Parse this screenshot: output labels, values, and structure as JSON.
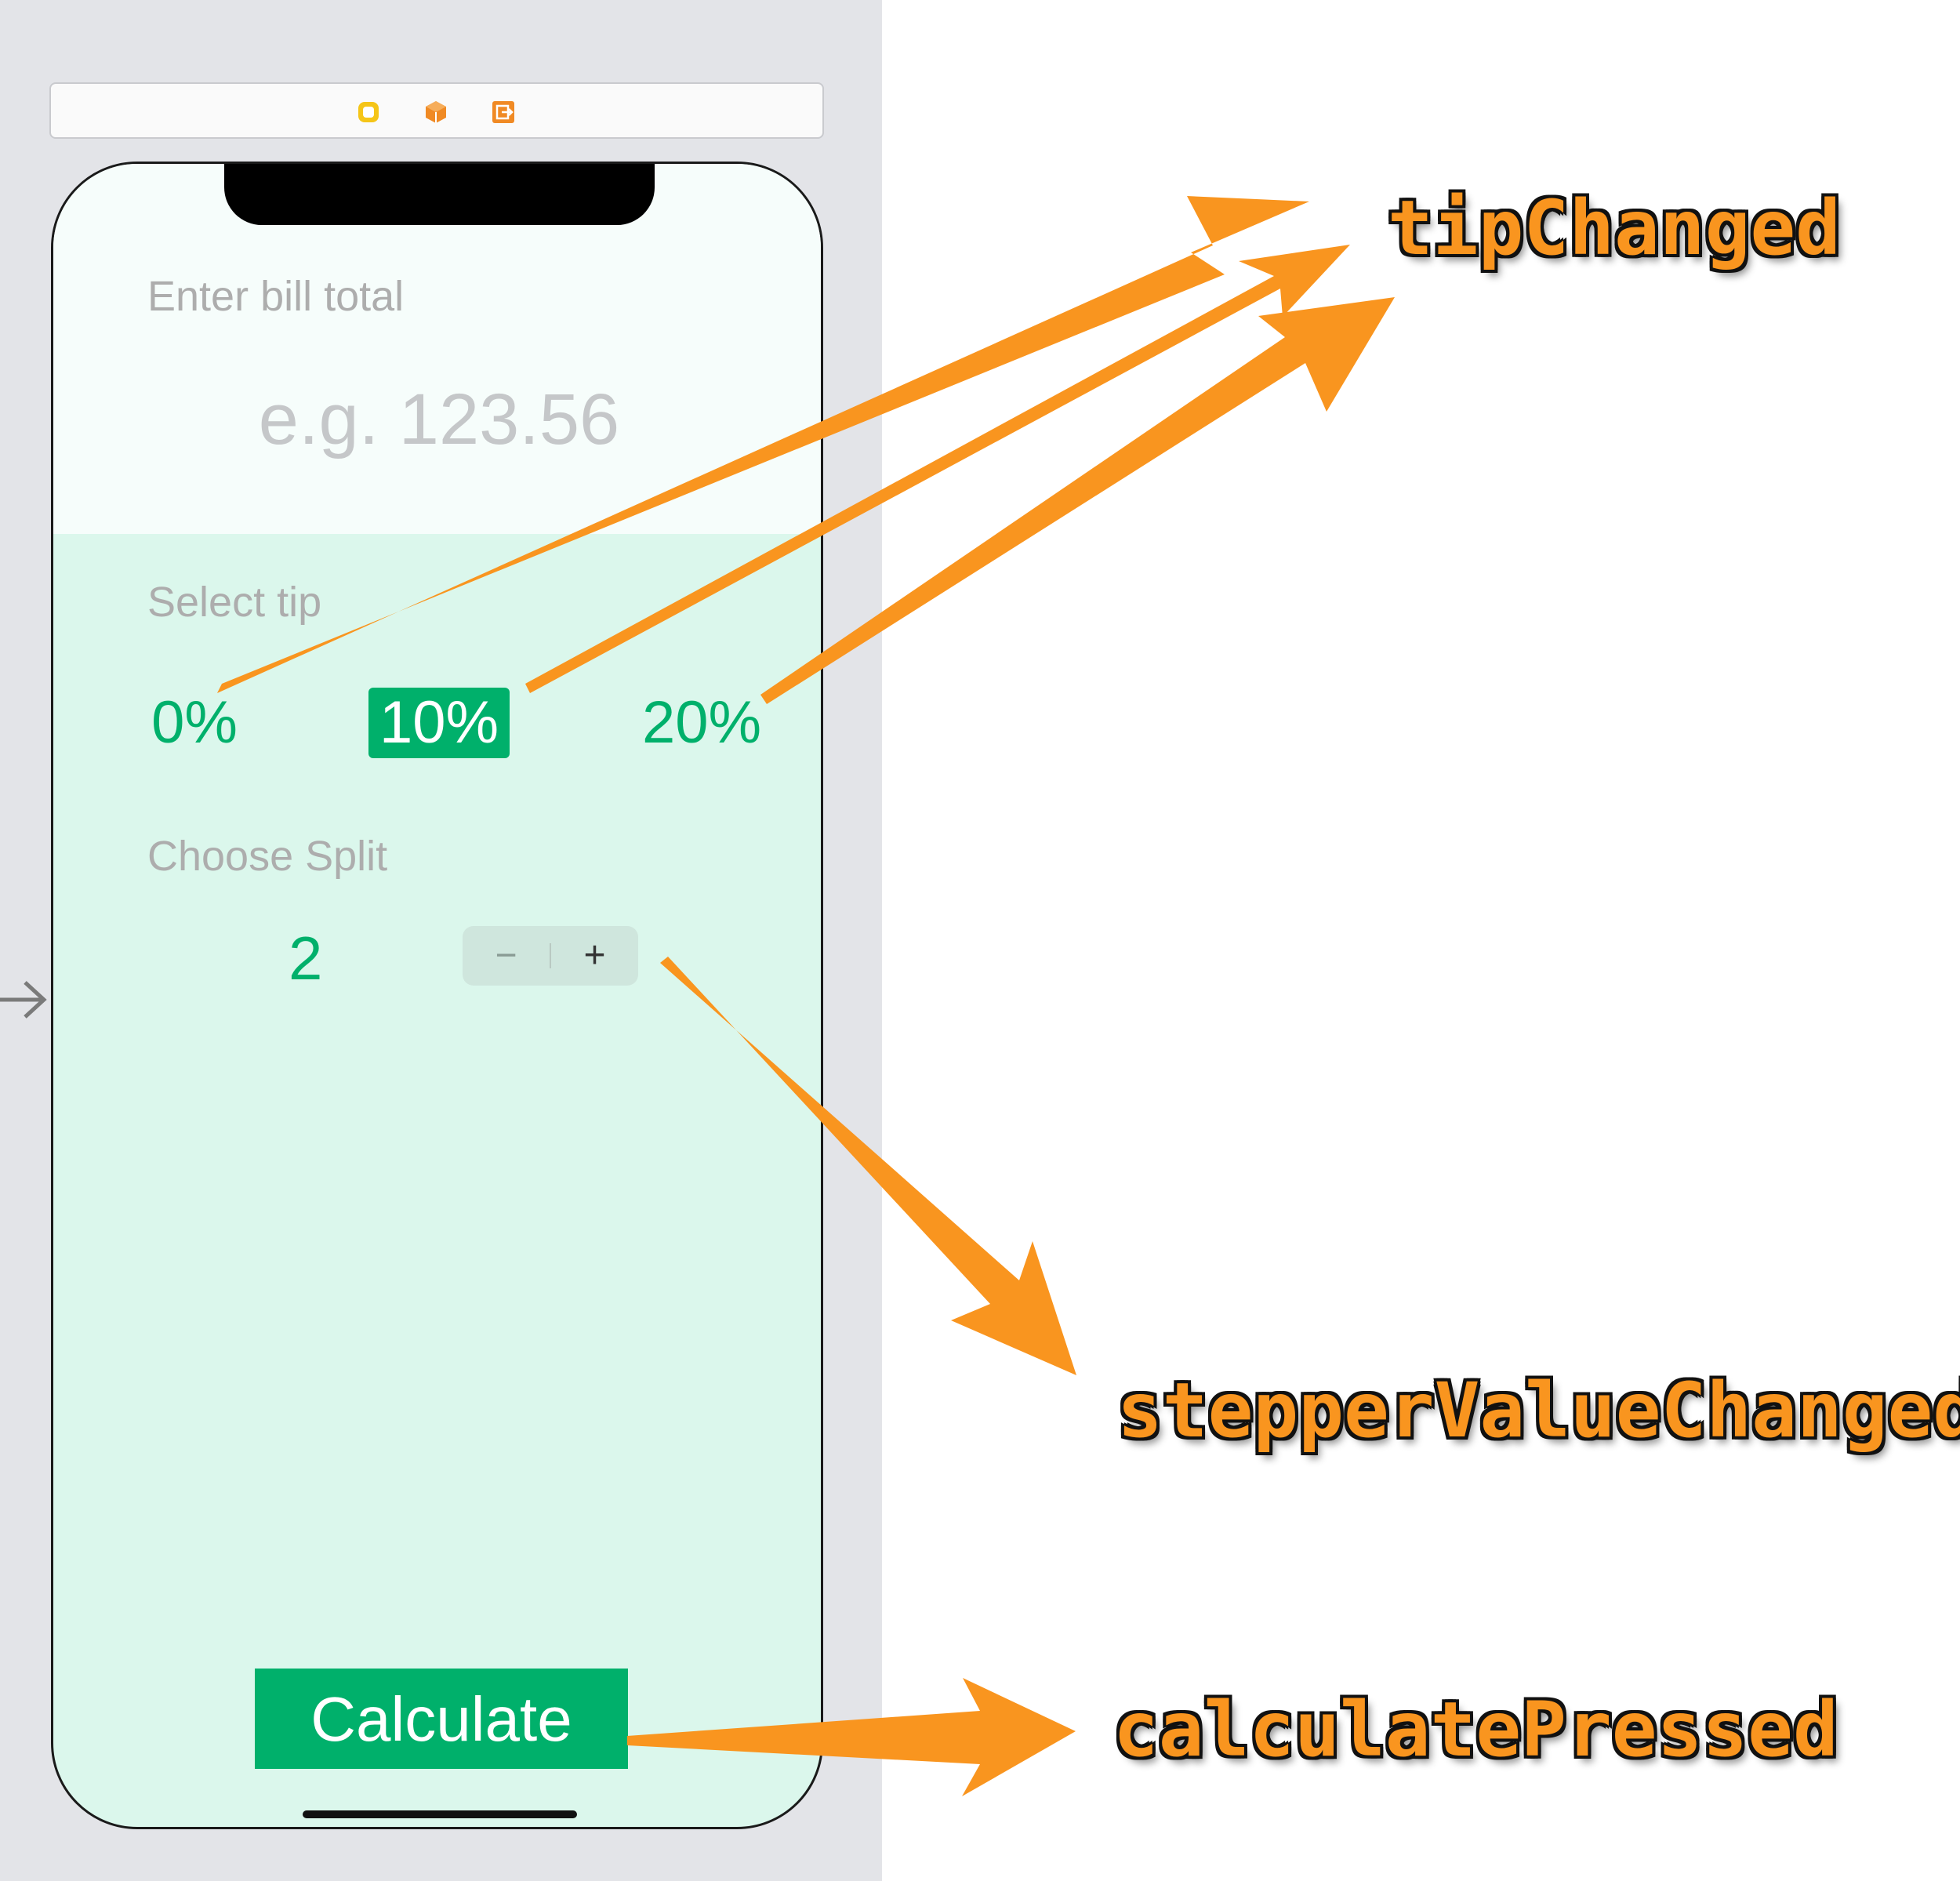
{
  "scene": {
    "icons": [
      "view-controller-icon",
      "first-responder-icon",
      "exit-icon"
    ]
  },
  "bill": {
    "label": "Enter bill total",
    "placeholder": "e.g. 123.56"
  },
  "tip": {
    "label": "Select tip",
    "options": [
      "0%",
      "10%",
      "20%"
    ],
    "selected": "10%"
  },
  "split": {
    "label": "Choose Split",
    "value": "2",
    "stepper_minus": "−",
    "stepper_plus": "+"
  },
  "calculate": {
    "label": "Calculate"
  },
  "annotations": {
    "tip_action": "tipChanged",
    "stepper_action": "stepperValueChanged",
    "calculate_action": "calculatePressed"
  },
  "colors": {
    "accent": "#00b06b",
    "arrow": "#f9951f",
    "top_bg": "#f6fdfb",
    "bottom_bg": "#dbf7ec"
  }
}
